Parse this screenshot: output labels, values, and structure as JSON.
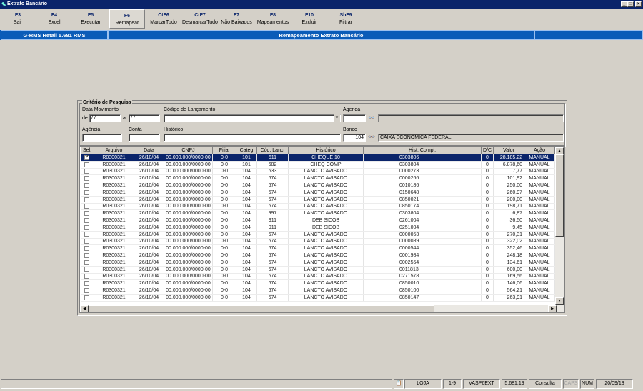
{
  "window": {
    "title": "Extrato Bancário",
    "minimize": "_",
    "maximize": "□",
    "close": "×"
  },
  "toolbar": [
    {
      "key": "F3",
      "label": "Sair"
    },
    {
      "key": "F4",
      "label": "Excel"
    },
    {
      "key": "F5",
      "label": "Executar"
    },
    {
      "key": "F6",
      "label": "Remapear"
    },
    {
      "key": "CtF6",
      "label": "MarcarTudo"
    },
    {
      "key": "CtF7",
      "label": "DesmarcarTudo"
    },
    {
      "key": "F7",
      "label": "Não Baixados"
    },
    {
      "key": "F8",
      "label": "Mapeamentos"
    },
    {
      "key": "F10",
      "label": "Excluir"
    },
    {
      "key": "ShF9",
      "label": "Filtrar"
    }
  ],
  "header": {
    "app": "G-RMS Retail 5.681 RMS",
    "screen": "Remapeamento Extrato Bancário"
  },
  "criteria": {
    "title": "Critério de Pesquisa",
    "data_movimento": "Data Movimento",
    "de": "de",
    "date_from": " / /",
    "a": "a",
    "date_to": " / /",
    "codigo_lancamento": "Código de Lançamento",
    "codigo_value": "",
    "agenda": "Agenda",
    "agenda_value": "",
    "agenda_desc": "",
    "agencia": "Agência",
    "agencia_value": "",
    "conta": "Conta",
    "conta_value": "",
    "historico": "Histórico",
    "historico_value": "",
    "banco": "Banco",
    "banco_value": "104",
    "banco_desc": "CAIXA ECONOMICA FEDERAL"
  },
  "grid": {
    "columns": [
      "Sel.",
      "Arquivo",
      "Data",
      "CNPJ",
      "Filial",
      "Categ",
      "Cód. Lanc.",
      "Histórico",
      "Hist. Compl.",
      "D/C",
      "Valor",
      "Ação"
    ],
    "rows": [
      [
        true,
        "R0300321",
        "26/10/04",
        "00.000.000/0000-00",
        "0-0",
        "101",
        "611",
        "CHEQUE  10",
        "0303806",
        "0",
        "28.185,22",
        "MANUAL"
      ],
      [
        false,
        "R0300321",
        "26/10/04",
        "00.000.000/0000-00",
        "0-0",
        "101",
        "682",
        "CHEQ COMP",
        "0303804",
        "0",
        "6.878,60",
        "MANUAL"
      ],
      [
        false,
        "R0300321",
        "26/10/04",
        "00.000.000/0000-00",
        "0-0",
        "104",
        "633",
        "LANCTO AVISADO",
        "0000273",
        "0",
        "7,77",
        "MANUAL"
      ],
      [
        false,
        "R0300321",
        "26/10/04",
        "00.000.000/0000-00",
        "0-0",
        "104",
        "674",
        "LANCTO AVISADO",
        "0000266",
        "0",
        "101,92",
        "MANUAL"
      ],
      [
        false,
        "R0300321",
        "26/10/04",
        "00.000.000/0000-00",
        "0-0",
        "104",
        "674",
        "LANCTO AVISADO",
        "0010186",
        "0",
        "250,00",
        "MANUAL"
      ],
      [
        false,
        "R0300321",
        "26/10/04",
        "00.000.000/0000-00",
        "0-0",
        "104",
        "674",
        "LANCTO AVISADO",
        "0150648",
        "0",
        "260,97",
        "MANUAL"
      ],
      [
        false,
        "R0300321",
        "26/10/04",
        "00.000.000/0000-00",
        "0-0",
        "104",
        "674",
        "LANCTO AVISADO",
        "0850021",
        "0",
        "200,00",
        "MANUAL"
      ],
      [
        false,
        "R0300321",
        "26/10/04",
        "00.000.000/0000-00",
        "0-0",
        "104",
        "674",
        "LANCTO AVISADO",
        "0850174",
        "0",
        "198,71",
        "MANUAL"
      ],
      [
        false,
        "R0300321",
        "26/10/04",
        "00.000.000/0000-00",
        "0-0",
        "104",
        "997",
        "LANCTO AVISADO",
        "0303804",
        "0",
        "6,87",
        "MANUAL"
      ],
      [
        false,
        "R0300321",
        "26/10/04",
        "00.000.000/0000-00",
        "0-0",
        "104",
        "911",
        "DEB SICOB",
        "0261004",
        "0",
        "36,50",
        "MANUAL"
      ],
      [
        false,
        "R0300321",
        "26/10/04",
        "00.000.000/0000-00",
        "0-0",
        "104",
        "911",
        "DEB SICOB",
        "0251004",
        "0",
        "9,45",
        "MANUAL"
      ],
      [
        false,
        "R0300321",
        "26/10/04",
        "00.000.000/0000-00",
        "0-0",
        "104",
        "674",
        "LANCTO AVISADO",
        "0000053",
        "0",
        "270,31",
        "MANUAL"
      ],
      [
        false,
        "R0300321",
        "26/10/04",
        "00.000.000/0000-00",
        "0-0",
        "104",
        "674",
        "LANCTO AVISADO",
        "0000089",
        "0",
        "322,02",
        "MANUAL"
      ],
      [
        false,
        "R0300321",
        "26/10/04",
        "00.000.000/0000-00",
        "0-0",
        "104",
        "674",
        "LANCTO AVISADO",
        "0000544",
        "0",
        "352,46",
        "MANUAL"
      ],
      [
        false,
        "R0300321",
        "26/10/04",
        "00.000.000/0000-00",
        "0-0",
        "104",
        "674",
        "LANCTO AVISADO",
        "0001984",
        "0",
        "248,18",
        "MANUAL"
      ],
      [
        false,
        "R0300321",
        "26/10/04",
        "00.000.000/0000-00",
        "0-0",
        "104",
        "674",
        "LANCTO AVISADO",
        "0002554",
        "0",
        "134,61",
        "MANUAL"
      ],
      [
        false,
        "R0300321",
        "26/10/04",
        "00.000.000/0000-00",
        "0-0",
        "104",
        "674",
        "LANCTO AVISADO",
        "0011813",
        "0",
        "600,00",
        "MANUAL"
      ],
      [
        false,
        "R0300321",
        "26/10/04",
        "00.000.000/0000-00",
        "0-0",
        "104",
        "674",
        "LANCTO AVISADO",
        "0271578",
        "0",
        "169,56",
        "MANUAL"
      ],
      [
        false,
        "R0300321",
        "26/10/04",
        "00.000.000/0000-00",
        "0-0",
        "104",
        "674",
        "LANCTO AVISADO",
        "0850010",
        "0",
        "146,06",
        "MANUAL"
      ],
      [
        false,
        "R0300321",
        "26/10/04",
        "00.000.000/0000-00",
        "0-0",
        "104",
        "674",
        "LANCTO AVISADO",
        "0850100",
        "0",
        "564,21",
        "MANUAL"
      ],
      [
        false,
        "R0300321",
        "26/10/04",
        "00.000.000/0000-00",
        "0-0",
        "104",
        "674",
        "LANCTO AVISADO",
        "0850147",
        "0",
        "263,91",
        "MANUAL"
      ]
    ]
  },
  "status": {
    "loja": "LOJA",
    "range": "1-9",
    "program": "VASP6EXT",
    "version": "5.681.19",
    "mode": "Consulta",
    "caps": "CAPS",
    "num": "NUM",
    "date": "20/09/13"
  },
  "colors": {
    "titlebar": "#0a246a",
    "header": "#0b5cb8",
    "selected_row": "#0a246a"
  }
}
